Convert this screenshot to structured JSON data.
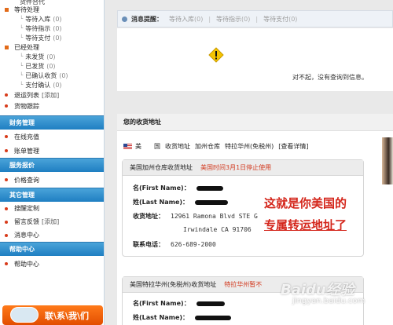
{
  "sidebar": {
    "top_partial": "货件合代",
    "waiting": {
      "label": "等待处理",
      "items": [
        {
          "label": "等待入库",
          "count": "(0)"
        },
        {
          "label": "等待指示",
          "count": "(0)"
        },
        {
          "label": "等待支付",
          "count": "(0)"
        }
      ]
    },
    "processed": {
      "label": "已经处理",
      "items": [
        {
          "label": "未发货",
          "count": "(0)"
        },
        {
          "label": "已发货",
          "count": "(0)"
        },
        {
          "label": "已确认收货",
          "count": "(0)"
        },
        {
          "label": "支付确认",
          "count": "(0)"
        }
      ]
    },
    "returns": {
      "label": "退运列表",
      "action": "[添加]"
    },
    "tracking": {
      "label": "货物跟踪"
    },
    "finance": {
      "header": "财务管理",
      "items": [
        {
          "label": "在线充值"
        },
        {
          "label": "账单管理"
        }
      ]
    },
    "quote": {
      "header": "服务报价",
      "items": [
        {
          "label": "价格查询"
        }
      ]
    },
    "other": {
      "header": "其它管理",
      "items": [
        {
          "label": "搜醒定制"
        },
        {
          "label": "留言反馈",
          "action": "[添加]"
        },
        {
          "label": "消息中心"
        }
      ]
    },
    "help": {
      "header": "帮助中心",
      "items": [
        {
          "label": "帮助中心"
        }
      ]
    },
    "contact_banner": "联\\系\\我\\们"
  },
  "notice": {
    "title": "消息提醒：",
    "items": [
      {
        "label": "等待入库",
        "count": "(0)"
      },
      {
        "label": "等待指示",
        "count": "(0)"
      },
      {
        "label": "等待支付",
        "count": "(0)"
      }
    ]
  },
  "empty_text": "对不起，没有查询到信息。",
  "address": {
    "title": "您的收货地址",
    "tabs": [
      "美　　国",
      "收货地址",
      "加州仓库",
      "特拉华州(免税州)",
      "[查看详情]"
    ],
    "card1": {
      "name": "美国加州仓库收货地址",
      "warning": "美国时间3月1日停止使用",
      "rows": [
        {
          "label": "名(First Name)：",
          "value": ""
        },
        {
          "label": "姓(Last Name)：",
          "value": ""
        },
        {
          "label": "收货地址：",
          "value": "12961 Ramona Blvd STE G"
        },
        {
          "label": "",
          "value": "Irwindale CA 91706"
        },
        {
          "label": "联系电话：",
          "value": "626-689-2000"
        }
      ]
    },
    "card2": {
      "name": "美国特拉华州(免税州)收货地址",
      "warning": "特拉华州暂不",
      "rows": [
        {
          "label": "名(First Name)：",
          "value": ""
        },
        {
          "label": "姓(Last Name)：",
          "value": ""
        }
      ]
    }
  },
  "callout": {
    "line1": "这就是你美国的",
    "line2": "专属转运地址了"
  },
  "watermark": {
    "line1": "Baidu经验",
    "line2": "jingyan.baidu.com"
  }
}
